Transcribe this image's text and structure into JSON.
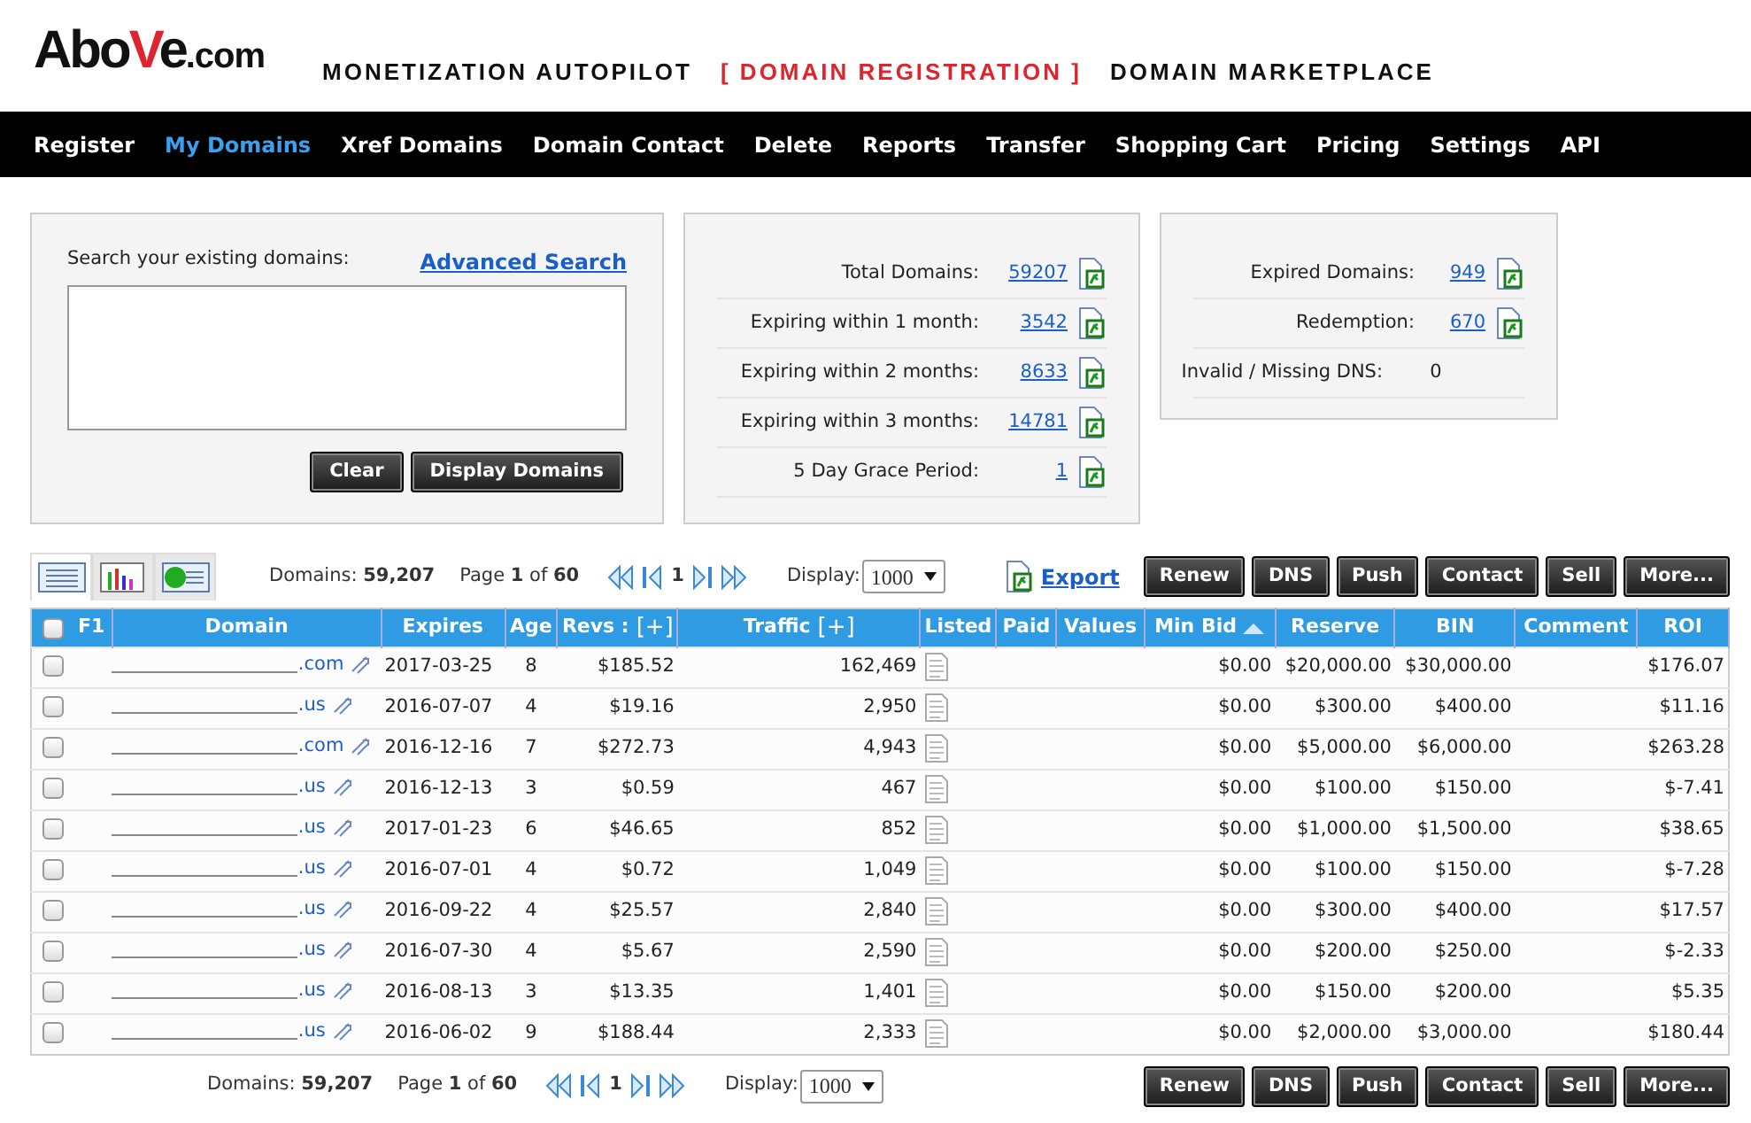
{
  "logo": {
    "parts": [
      {
        "text": "Abo",
        "accent": false
      },
      {
        "text": "V",
        "accent": true
      },
      {
        "text": "e",
        "accent": false
      },
      {
        "text": ".com",
        "accent": false
      }
    ]
  },
  "top_nav": [
    {
      "label": "MONETIZATION AUTOPILOT",
      "selected": false
    },
    {
      "label": "[ DOMAIN REGISTRATION ]",
      "selected": true
    },
    {
      "label": "DOMAIN MARKETPLACE",
      "selected": false
    }
  ],
  "main_nav": [
    {
      "label": "Register",
      "selected": false
    },
    {
      "label": "My Domains",
      "selected": true
    },
    {
      "label": "Xref Domains",
      "selected": false
    },
    {
      "label": "Domain Contact",
      "selected": false
    },
    {
      "label": "Delete",
      "selected": false
    },
    {
      "label": "Reports",
      "selected": false
    },
    {
      "label": "Transfer",
      "selected": false
    },
    {
      "label": "Shopping Cart",
      "selected": false
    },
    {
      "label": "Pricing",
      "selected": false
    },
    {
      "label": "Settings",
      "selected": false
    },
    {
      "label": "API",
      "selected": false
    }
  ],
  "search_panel": {
    "label": "Search your existing domains:",
    "advanced_link": "Advanced Search",
    "buttons": [
      "Clear",
      "Display Domains"
    ]
  },
  "stats": [
    {
      "label": "Total Domains:",
      "value": "59207",
      "linked": true
    },
    {
      "label": "Expiring within 1 month:",
      "value": "3542",
      "linked": true
    },
    {
      "label": "Expiring within 2 months:",
      "value": "8633",
      "linked": true
    },
    {
      "label": "Expiring within 3 months:",
      "value": "14781",
      "linked": true
    },
    {
      "label": "5 Day Grace Period:",
      "value": "1",
      "linked": true
    }
  ],
  "status_stats": [
    {
      "label": "Expired Domains:",
      "value": "949",
      "linked": true
    },
    {
      "label": "Redemption:",
      "value": "670",
      "linked": true
    },
    {
      "label": "Invalid / Missing DNS:",
      "value": "0",
      "linked": false
    }
  ],
  "view_tabs": [
    {
      "kind": "list",
      "selected": true
    },
    {
      "kind": "chart",
      "selected": false
    },
    {
      "kind": "money",
      "selected": false
    }
  ],
  "pager_top": {
    "domains_label": "Domains:",
    "domains": "59,207",
    "page_label": "Page",
    "page": "1",
    "of_label": "of",
    "pages": "60",
    "current": "1",
    "display_label": "Display:",
    "display": "1000"
  },
  "export": "Export",
  "actions_top": [
    "Renew",
    "DNS",
    "Push",
    "Contact",
    "Sell",
    "More..."
  ],
  "columns": [
    {
      "label": "F1",
      "kind": "select",
      "checked": false
    },
    {
      "label": "Domain"
    },
    {
      "label": "Expires"
    },
    {
      "label": "Age"
    },
    {
      "label": "Revs :",
      "expander": "[+]"
    },
    {
      "label": "Traffic",
      "expander": "[+]"
    },
    {
      "label": "Listed"
    },
    {
      "label": "Paid"
    },
    {
      "label": "Values"
    },
    {
      "label": "Min Bid",
      "sorted": true
    },
    {
      "label": "Reserve"
    },
    {
      "label": "BIN"
    },
    {
      "label": "Comment"
    },
    {
      "label": "ROI"
    }
  ],
  "rows": [
    {
      "checked": false,
      "domain": ".com",
      "expires": "2017-03-25",
      "age": "8",
      "revs": "$185.52",
      "traffic": "162,469",
      "min_bid": "$0.00",
      "reserve": "$20,000.00",
      "bin": "$30,000.00",
      "roi": "$176.07"
    },
    {
      "checked": false,
      "domain": ".us",
      "expires": "2016-07-07",
      "age": "4",
      "revs": "$19.16",
      "traffic": "2,950",
      "min_bid": "$0.00",
      "reserve": "$300.00",
      "bin": "$400.00",
      "roi": "$11.16"
    },
    {
      "checked": false,
      "domain": ".com",
      "expires": "2016-12-16",
      "age": "7",
      "revs": "$272.73",
      "traffic": "4,943",
      "min_bid": "$0.00",
      "reserve": "$5,000.00",
      "bin": "$6,000.00",
      "roi": "$263.28"
    },
    {
      "checked": false,
      "domain": ".us",
      "expires": "2016-12-13",
      "age": "3",
      "revs": "$0.59",
      "traffic": "467",
      "min_bid": "$0.00",
      "reserve": "$100.00",
      "bin": "$150.00",
      "roi": "$-7.41"
    },
    {
      "checked": false,
      "domain": ".us",
      "expires": "2017-01-23",
      "age": "6",
      "revs": "$46.65",
      "traffic": "852",
      "min_bid": "$0.00",
      "reserve": "$1,000.00",
      "bin": "$1,500.00",
      "roi": "$38.65"
    },
    {
      "checked": false,
      "domain": ".us",
      "expires": "2016-07-01",
      "age": "4",
      "revs": "$0.72",
      "traffic": "1,049",
      "min_bid": "$0.00",
      "reserve": "$100.00",
      "bin": "$150.00",
      "roi": "$-7.28"
    },
    {
      "checked": false,
      "domain": ".us",
      "expires": "2016-09-22",
      "age": "4",
      "revs": "$25.57",
      "traffic": "2,840",
      "min_bid": "$0.00",
      "reserve": "$300.00",
      "bin": "$400.00",
      "roi": "$17.57"
    },
    {
      "checked": false,
      "domain": ".us",
      "expires": "2016-07-30",
      "age": "4",
      "revs": "$5.67",
      "traffic": "2,590",
      "min_bid": "$0.00",
      "reserve": "$200.00",
      "bin": "$250.00",
      "roi": "$-2.33"
    },
    {
      "checked": false,
      "domain": ".us",
      "expires": "2016-08-13",
      "age": "3",
      "revs": "$13.35",
      "traffic": "1,401",
      "min_bid": "$0.00",
      "reserve": "$150.00",
      "bin": "$200.00",
      "roi": "$5.35"
    },
    {
      "checked": false,
      "domain": ".us",
      "expires": "2016-06-02",
      "age": "9",
      "revs": "$188.44",
      "traffic": "2,333",
      "min_bid": "$0.00",
      "reserve": "$2,000.00",
      "bin": "$3,000.00",
      "roi": "$180.44"
    }
  ],
  "pager_bottom": {
    "domains_label": "Domains:",
    "domains": "59,207",
    "page_label": "Page",
    "page": "1",
    "of_label": "of",
    "pages": "60",
    "current": "1",
    "display_label": "Display:",
    "display": "1000"
  },
  "actions_bottom": [
    "Renew",
    "DNS",
    "Push",
    "Contact",
    "Sell",
    "More..."
  ]
}
